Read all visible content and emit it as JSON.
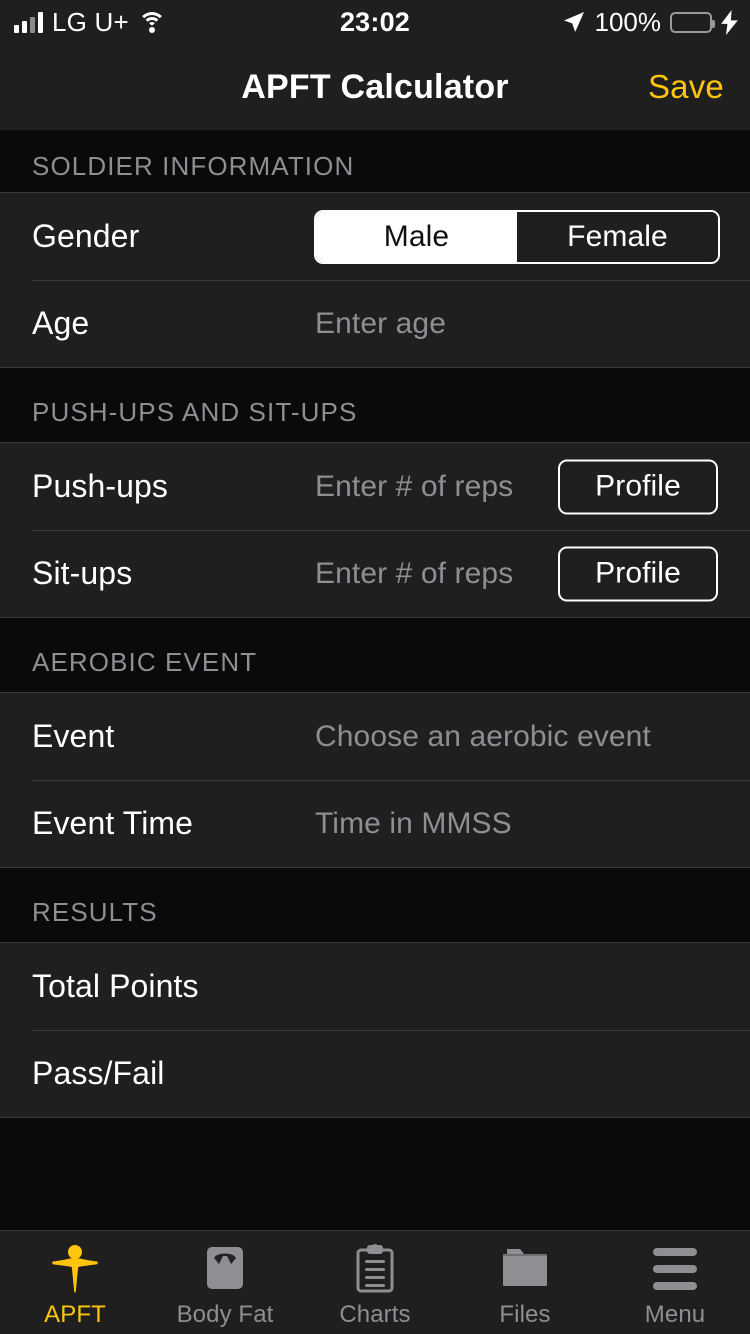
{
  "status_bar": {
    "carrier": "LG U+",
    "time": "23:02",
    "battery_percent": "100%",
    "battery_color": "#4CD964",
    "signal_icon": "signal-bars-icon",
    "wifi_icon": "wifi-icon",
    "location_icon": "location-arrow-icon",
    "charging_icon": "lightning-bolt-icon"
  },
  "navbar": {
    "title": "APFT Calculator",
    "save_label": "Save",
    "save_color": "#FFC40C"
  },
  "sections": [
    {
      "header": "SOLDIER INFORMATION",
      "rows": [
        {
          "label": "Gender",
          "control": "segmented",
          "options": [
            "Male",
            "Female"
          ],
          "selected": "Male"
        },
        {
          "label": "Age",
          "control": "text",
          "value": "",
          "placeholder": "Enter age"
        }
      ]
    },
    {
      "header": "PUSH-UPS AND SIT-UPS",
      "rows": [
        {
          "label": "Push-ups",
          "control": "text",
          "value": "",
          "placeholder": "Enter # of reps",
          "button": "Profile"
        },
        {
          "label": "Sit-ups",
          "control": "text",
          "value": "",
          "placeholder": "Enter # of reps",
          "button": "Profile"
        }
      ]
    },
    {
      "header": "AEROBIC EVENT",
      "rows": [
        {
          "label": "Event",
          "control": "text",
          "value": "",
          "placeholder": "Choose an aerobic event"
        },
        {
          "label": "Event Time",
          "control": "text",
          "value": "",
          "placeholder": "Time in MMSS"
        }
      ]
    },
    {
      "header": "RESULTS",
      "rows": [
        {
          "label": "Total Points",
          "control": "readonly",
          "value": ""
        },
        {
          "label": "Pass/Fail",
          "control": "readonly",
          "value": ""
        }
      ]
    }
  ],
  "tabbar": {
    "active_color": "#FFC40C",
    "inactive_color": "#8e8e93",
    "tabs": [
      {
        "label": "APFT",
        "icon": "person-figure-icon",
        "active": true
      },
      {
        "label": "Body Fat",
        "icon": "scale-icon",
        "active": false
      },
      {
        "label": "Charts",
        "icon": "clipboard-icon",
        "active": false
      },
      {
        "label": "Files",
        "icon": "folder-icon",
        "active": false
      },
      {
        "label": "Menu",
        "icon": "hamburger-menu-icon",
        "active": false
      }
    ]
  }
}
